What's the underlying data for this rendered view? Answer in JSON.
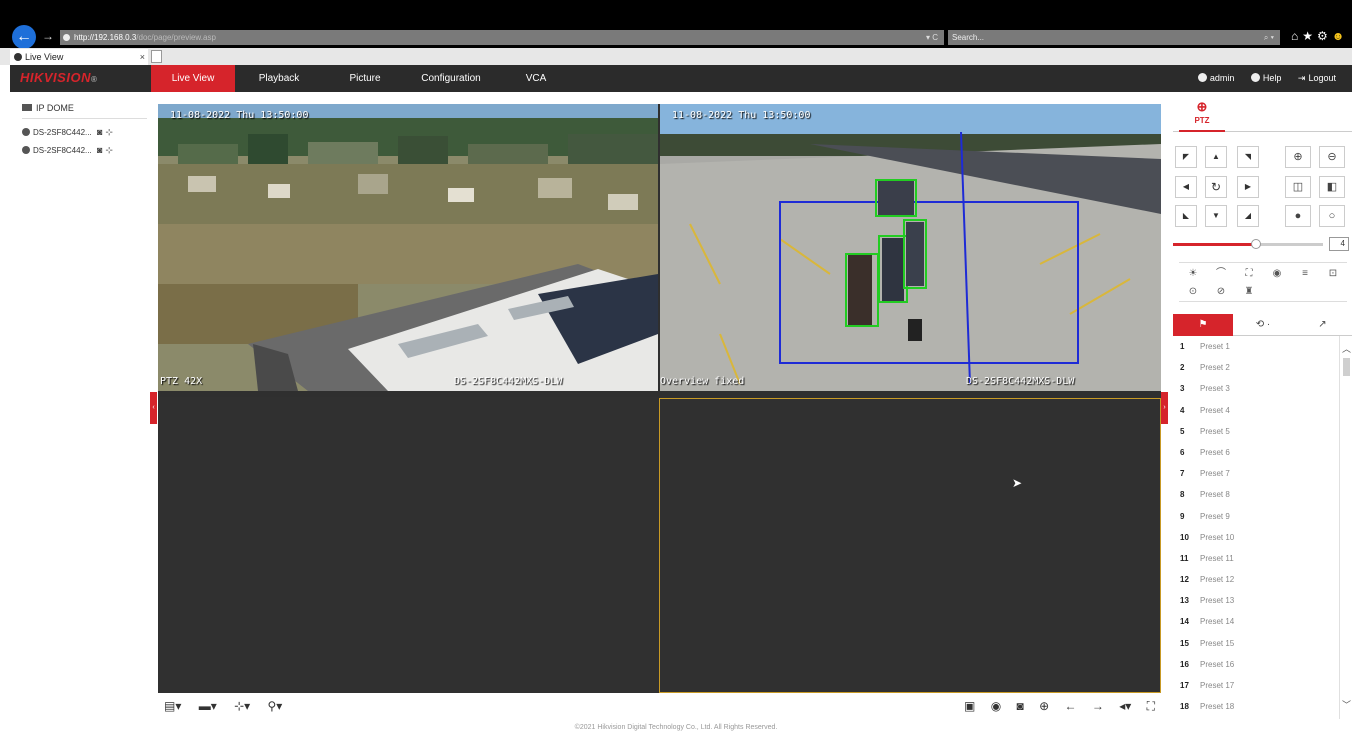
{
  "browser": {
    "address_host": "http://192.168.0.3",
    "address_path": "/doc/page/preview.asp",
    "address_controls": "▾ C",
    "search_placeholder": "Search...",
    "search_icon": "⌕ ▾",
    "tab_title": "Live View",
    "tab_close": "×"
  },
  "app": {
    "brand": "HIKVISION",
    "brand_mark": "®",
    "nav": [
      {
        "label": "Live View",
        "active": true
      },
      {
        "label": "Playback"
      },
      {
        "label": "Picture"
      },
      {
        "label": "Configuration"
      },
      {
        "label": "VCA"
      }
    ],
    "user": "admin",
    "help": "Help",
    "logout": "Logout"
  },
  "device_tree": {
    "root": "IP DOME",
    "channels": [
      {
        "name": "DS-2SF8C442..."
      },
      {
        "name": "DS-2SF8C442..."
      }
    ]
  },
  "video": {
    "pane1": {
      "timestamp": "11-08-2022 Thu 13:50:00",
      "bottom_left": "PTZ 42X",
      "bottom_right": "DS-2SF8C442MXS-DLW"
    },
    "pane2": {
      "timestamp": "11-08-2022 Thu 13:50:00",
      "bottom_left": "Overview fixed",
      "bottom_right": "DS-2SF8C442MXS-DLW"
    }
  },
  "ptz": {
    "tab_label": "PTZ",
    "speed": "4",
    "speed_fraction": 0.55,
    "presets": [
      {
        "num": "1",
        "label": "Preset 1"
      },
      {
        "num": "2",
        "label": "Preset 2"
      },
      {
        "num": "3",
        "label": "Preset 3"
      },
      {
        "num": "4",
        "label": "Preset 4"
      },
      {
        "num": "5",
        "label": "Preset 5"
      },
      {
        "num": "6",
        "label": "Preset 6"
      },
      {
        "num": "7",
        "label": "Preset 7"
      },
      {
        "num": "8",
        "label": "Preset 8"
      },
      {
        "num": "9",
        "label": "Preset 9"
      },
      {
        "num": "10",
        "label": "Preset 10"
      },
      {
        "num": "11",
        "label": "Preset 11"
      },
      {
        "num": "12",
        "label": "Preset 12"
      },
      {
        "num": "13",
        "label": "Preset 13"
      },
      {
        "num": "14",
        "label": "Preset 14"
      },
      {
        "num": "15",
        "label": "Preset 15"
      },
      {
        "num": "16",
        "label": "Preset 16"
      },
      {
        "num": "17",
        "label": "Preset 17"
      },
      {
        "num": "18",
        "label": "Preset 18"
      }
    ]
  },
  "footer": {
    "copyright": "©2021 Hikvision Digital Technology Co., Ltd. All Rights Reserved."
  },
  "colors": {
    "accent": "#d6242b",
    "appbar": "#2b2b2b",
    "detect_box": "#22cc22",
    "rule_box": "#1e2bd6"
  }
}
